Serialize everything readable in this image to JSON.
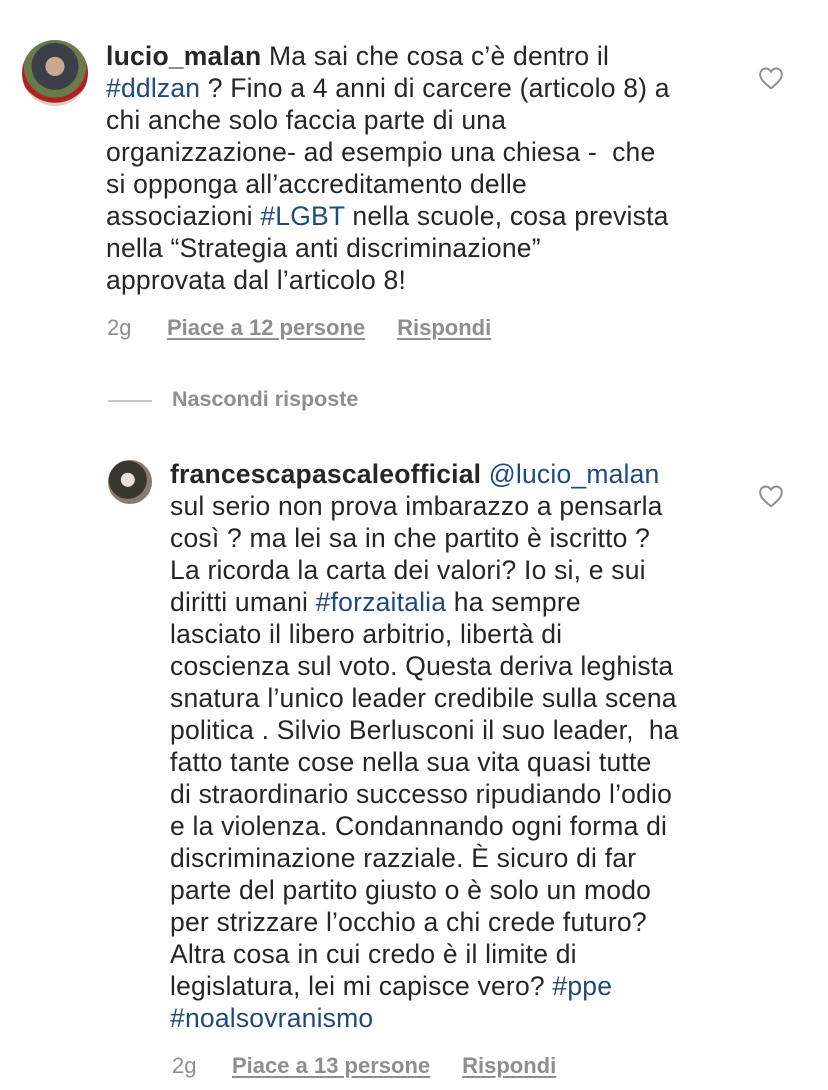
{
  "comment": {
    "username": "lucio_malan",
    "segments": [
      {
        "t": " Ma sai che cosa c’è dentro il\n",
        "tag": false
      },
      {
        "t": "#ddlzan",
        "tag": true
      },
      {
        "t": " ? Fino a 4 anni di carcere (articolo 8) a\nchi anche solo faccia parte di una\norganizzazione- ad esempio una chiesa -  che\nsi opponga all’accreditamento delle\nassociazioni ",
        "tag": false
      },
      {
        "t": "#LGBT",
        "tag": true
      },
      {
        "t": " nella scuole, cosa prevista\nnella “Strategia anti discriminazione”\napprovata dal l’articolo 8!",
        "tag": false
      }
    ],
    "time": "2g",
    "likes": "Piace a 12 persone",
    "reply": "Rispondi"
  },
  "hide_replies": "Nascondi risposte",
  "reply": {
    "username": "francescapascaleofficial",
    "segments": [
      {
        "t": " ",
        "tag": false
      },
      {
        "t": "@lucio_malan",
        "tag": true
      },
      {
        "t": "\nsul serio non prova imbarazzo a pensarla\ncosì ? ma lei sa in che partito è iscritto ?\nLa ricorda la carta dei valori? Io si, e sui\ndiritti umani ",
        "tag": false
      },
      {
        "t": "#forzaitalia",
        "tag": true
      },
      {
        "t": " ha sempre\nlasciato il libero arbitrio, libertà di\ncoscienza sul voto. Questa deriva leghista\nsnatura l’unico leader credibile sulla scena\npolitica . Silvio Berlusconi il suo leader,  ha\nfatto tante cose nella sua vita quasi tutte\ndi straordinario successo ripudiando l’odio\ne la violenza. Condannando ogni forma di\ndiscriminazione razziale. È sicuro di far\nparte del partito giusto o è solo un modo\nper strizzare l’occhio a chi crede futuro?\nAltra cosa in cui credo è il limite di\nlegislatura, lei mi capisce vero? ",
        "tag": false
      },
      {
        "t": "#ppe",
        "tag": true
      },
      {
        "t": "\n",
        "tag": false
      },
      {
        "t": "#noalsovranismo",
        "tag": true
      }
    ],
    "time": "2g",
    "likes": "Piace a 13 persone",
    "reply": "Rispondi"
  },
  "icons": {
    "like": "heart-outline-icon"
  },
  "colors": {
    "hashtag": "#1e4a7e",
    "meta": "#8e8e8e",
    "text": "#262626"
  }
}
